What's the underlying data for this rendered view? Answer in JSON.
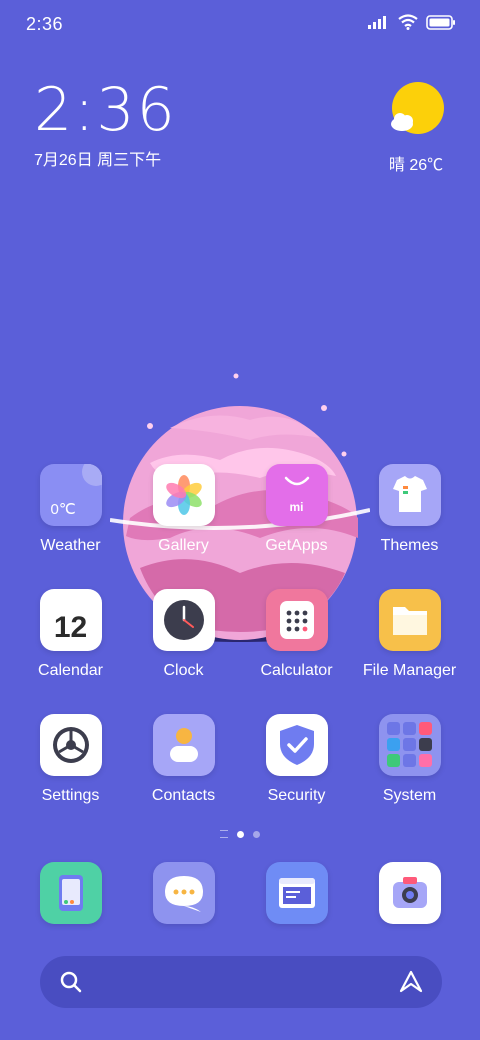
{
  "status_bar": {
    "time": "2:36",
    "signal_icon": "signal-bars-icon",
    "wifi_icon": "wifi-icon",
    "battery_icon": "battery-icon"
  },
  "clock_widget": {
    "time": "2:36",
    "date": "7月26日 周三下午"
  },
  "weather_widget": {
    "text": "晴 26℃",
    "icon": "sun-cloud-icon"
  },
  "apps": [
    {
      "label": "Weather",
      "icon": "weather-icon",
      "badge": "0℃"
    },
    {
      "label": "Gallery",
      "icon": "gallery-flower-icon"
    },
    {
      "label": "GetApps",
      "icon": "getapps-bag-icon",
      "badge": "mi"
    },
    {
      "label": "Themes",
      "icon": "themes-shirt-icon"
    },
    {
      "label": "Calendar",
      "icon": "calendar-icon",
      "badge": "12"
    },
    {
      "label": "Clock",
      "icon": "clock-icon"
    },
    {
      "label": "Calculator",
      "icon": "calculator-icon"
    },
    {
      "label": "File Manager",
      "icon": "folder-icon"
    },
    {
      "label": "Settings",
      "icon": "settings-gear-icon"
    },
    {
      "label": "Contacts",
      "icon": "contacts-person-icon"
    },
    {
      "label": "Security",
      "icon": "security-shield-icon"
    },
    {
      "label": "System",
      "icon": "system-folder-icon"
    }
  ],
  "dock": [
    "phone-icon",
    "messages-icon",
    "browser-icon",
    "camera-icon"
  ],
  "search": {
    "icon": "search-icon",
    "assistant_icon": "assistant-icon"
  },
  "colors": {
    "background": "#5b5fd9",
    "accent": "#ffffff"
  }
}
